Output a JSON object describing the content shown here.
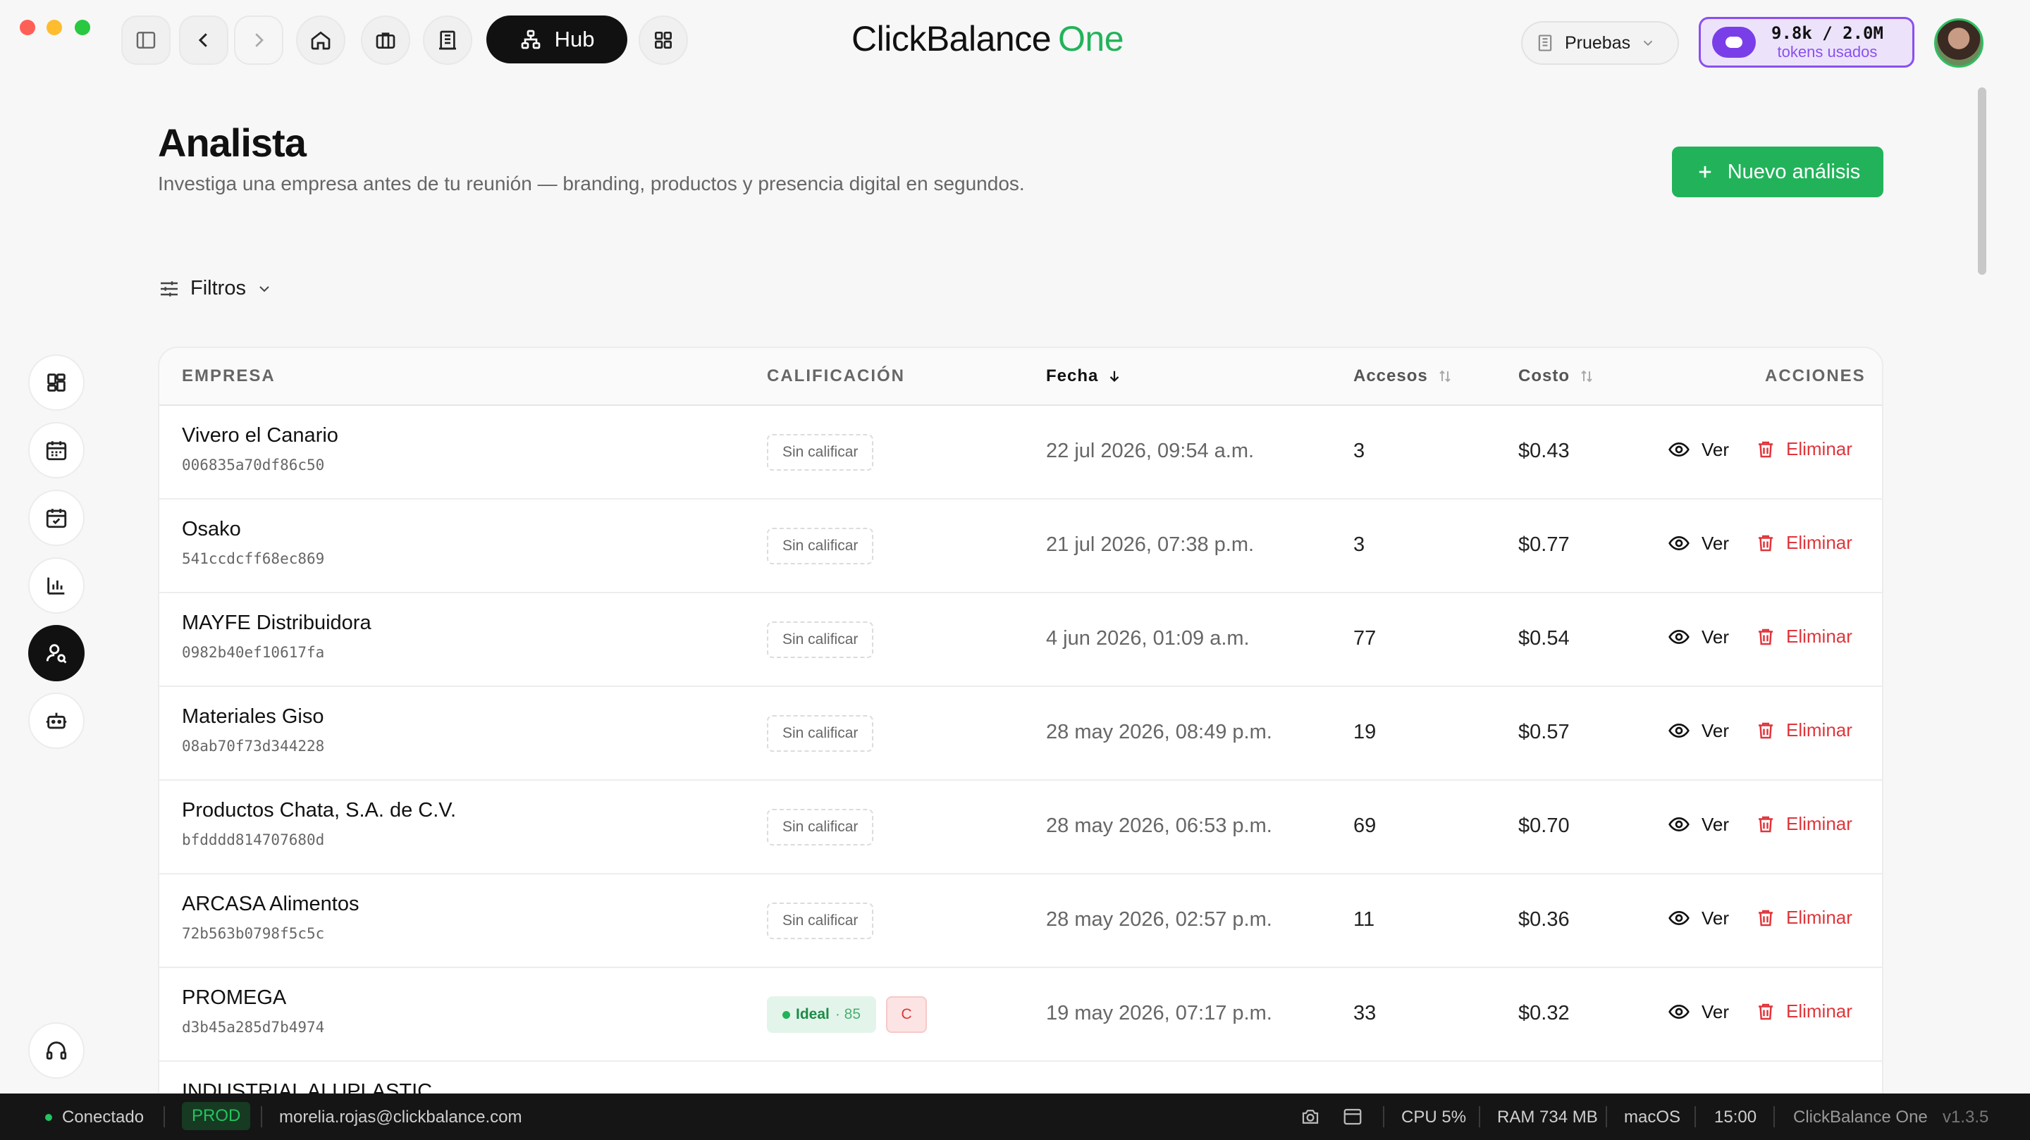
{
  "app": {
    "brand_part1": "ClickBalance",
    "brand_part2": "One",
    "hub_label": "Hub",
    "workspace": "Pruebas",
    "tokens_value": "9.8k / 2.0M",
    "tokens_label": "tokens usados"
  },
  "page": {
    "title": "Analista",
    "subtitle": "Investiga una empresa antes de tu reunión — branding, productos y presencia digital en segundos.",
    "new_button": "Nuevo análisis",
    "filters_label": "Filtros"
  },
  "table": {
    "headers": {
      "empresa": "EMPRESA",
      "calificacion": "CALIFICACIÓN",
      "fecha": "Fecha",
      "accesos": "Accesos",
      "costo": "Costo",
      "acciones": "ACCIONES"
    },
    "view_label": "Ver",
    "delete_label": "Eliminar",
    "unrated_label": "Sin calificar",
    "rows": [
      {
        "name": "Vivero el Canario",
        "id": "006835a70df86c50",
        "rating": "Sin calificar",
        "date": "22 jul 2026, 09:54 a.m.",
        "accesses": "3",
        "cost": "$0.43"
      },
      {
        "name": "Osako",
        "id": "541ccdcff68ec869",
        "rating": "Sin calificar",
        "date": "21 jul 2026, 07:38 p.m.",
        "accesses": "3",
        "cost": "$0.77"
      },
      {
        "name": "MAYFE Distribuidora",
        "id": "0982b40ef10617fa",
        "rating": "Sin calificar",
        "date": "4 jun 2026, 01:09 a.m.",
        "accesses": "77",
        "cost": "$0.54"
      },
      {
        "name": "Materiales Giso",
        "id": "08ab70f73d344228",
        "rating": "Sin calificar",
        "date": "28 may 2026, 08:49 p.m.",
        "accesses": "19",
        "cost": "$0.57"
      },
      {
        "name": "Productos Chata, S.A. de C.V.",
        "id": "bfdddd814707680d",
        "rating": "Sin calificar",
        "date": "28 may 2026, 06:53 p.m.",
        "accesses": "69",
        "cost": "$0.70"
      },
      {
        "name": "ARCASA Alimentos",
        "id": "72b563b0798f5c5c",
        "rating": "Sin calificar",
        "date": "28 may 2026, 02:57 p.m.",
        "accesses": "11",
        "cost": "$0.36"
      },
      {
        "name": "PROMEGA",
        "id": "d3b45a285d7b4974",
        "rating_label": "Ideal",
        "rating_score": "· 85",
        "grade": "C",
        "date": "19 may 2026, 07:17 p.m.",
        "accesses": "33",
        "cost": "$0.32"
      },
      {
        "name": "INDUSTRIAL ALUPLASTIC"
      }
    ]
  },
  "statusbar": {
    "connection": "Conectado",
    "env": "PROD",
    "email": "morelia.rojas@clickbalance.com",
    "cpu": "CPU 5%",
    "ram": "RAM 734 MB",
    "os": "macOS",
    "time": "15:00",
    "app_name": "ClickBalance One",
    "version": "v1.3.5"
  },
  "colors": {
    "accent_green": "#22b35a",
    "danger_red": "#e0353a",
    "token_purple": "#7a3ee8"
  }
}
